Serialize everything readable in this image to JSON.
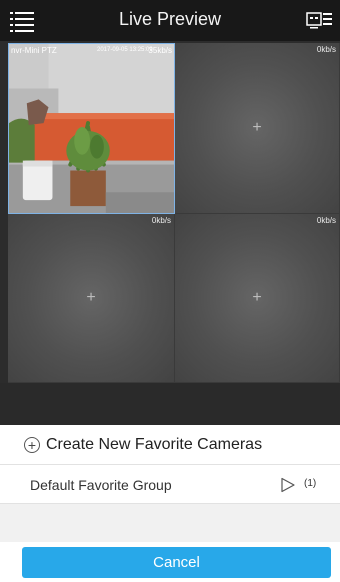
{
  "header": {
    "title": "Live Preview",
    "menu_icon": "list-menu-icon",
    "layout_icon": "camera-layout-icon"
  },
  "grid": {
    "tiles": [
      {
        "camera_name": "nvr-Mini PTZ",
        "timestamp": "2017-09-05 13:25:09",
        "speed": "35kb/s",
        "active": true
      },
      {
        "speed": "0kb/s",
        "add_icon": "+"
      },
      {
        "speed": "0kb/s",
        "add_icon": "+"
      },
      {
        "speed": "0kb/s",
        "add_icon": "+"
      }
    ]
  },
  "sheet": {
    "create_label": "Create New Favorite Cameras",
    "create_icon": "+",
    "group_label": "Default Favorite Group",
    "group_count": "(1)",
    "cancel_label": "Cancel"
  },
  "colors": {
    "header_bg": "#181818",
    "grid_bg": "#2c2c2c",
    "active_border": "#7fb3e6",
    "accent": "#28a8e9"
  }
}
